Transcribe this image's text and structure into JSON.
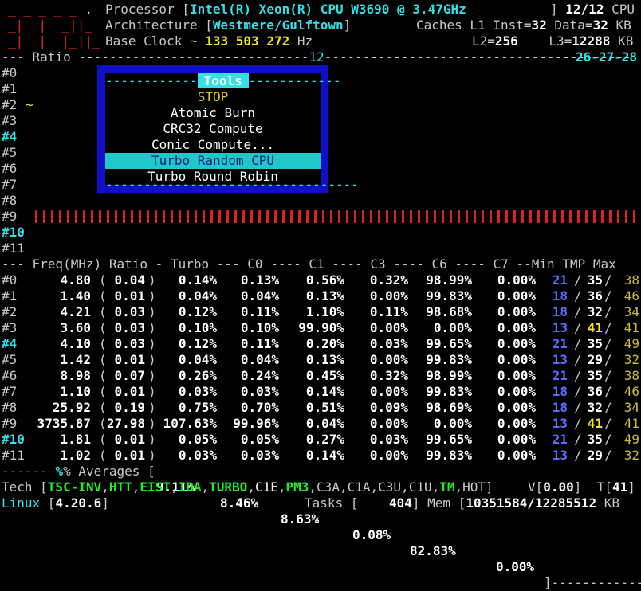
{
  "header": {
    "processor_label": "Processor",
    "processor_value": "Intel(R) Xeon(R) CPU W3690 @ 3.47GHz",
    "cpu_count": "12/12",
    "cpu_label": "CPU",
    "arch_label": "Architecture",
    "arch_value": "Westmere/Gulftown",
    "caches_label": "Caches L1 Inst=",
    "l1_inst": "32",
    "data_label": "Data=",
    "l1_data": "32",
    "kb": "KB",
    "clock_label": "Base Clock",
    "clock_value": "133 503 272",
    "hz": "Hz",
    "l2_label": "L2=",
    "l2": "256",
    "l3_label": "L3=",
    "l3": "12288",
    "ratio_label": "Ratio",
    "ratio_mid": "12",
    "ratio_end": "26-27-28"
  },
  "core_ids": [
    "#0",
    "#1",
    "#2",
    "#3",
    "#4",
    "#5",
    "#6",
    "#7",
    "#8",
    "#9",
    "#10",
    "#11"
  ],
  "tools_menu": {
    "title": "Tools",
    "items": [
      "STOP",
      "Atomic Burn",
      "CRC32 Compute",
      "Conic Compute...",
      "Turbo Random CPU",
      "Turbo Round Robin"
    ],
    "selected": "Turbo Random CPU"
  },
  "table": {
    "headers": [
      "Freq(MHz)",
      "Ratio",
      "Turbo",
      "C0",
      "C1",
      "C3",
      "C6",
      "C7",
      "Min",
      "TMP",
      "Max"
    ],
    "rows": [
      {
        "id": "#0",
        "freq": "4.80",
        "ratio": "0.04",
        "turbo": "0.14%",
        "c0": "0.13%",
        "c1": "0.56%",
        "c3": "0.32%",
        "c6": "98.99%",
        "c7": "0.00%",
        "min": "21",
        "tmp": "35",
        "max": "38"
      },
      {
        "id": "#1",
        "freq": "1.40",
        "ratio": "0.01",
        "turbo": "0.04%",
        "c0": "0.04%",
        "c1": "0.13%",
        "c3": "0.00%",
        "c6": "99.83%",
        "c7": "0.00%",
        "min": "18",
        "tmp": "36",
        "max": "46"
      },
      {
        "id": "#2",
        "freq": "4.21",
        "ratio": "0.03",
        "turbo": "0.12%",
        "c0": "0.11%",
        "c1": "1.10%",
        "c3": "0.11%",
        "c6": "98.68%",
        "c7": "0.00%",
        "min": "18",
        "tmp": "32",
        "max": "34"
      },
      {
        "id": "#3",
        "freq": "3.60",
        "ratio": "0.03",
        "turbo": "0.10%",
        "c0": "0.10%",
        "c1": "99.90%",
        "c3": "0.00%",
        "c6": "0.00%",
        "c7": "0.00%",
        "min": "13",
        "tmp": "41",
        "max": "41"
      },
      {
        "id": "#4",
        "freq": "4.10",
        "ratio": "0.03",
        "turbo": "0.12%",
        "c0": "0.11%",
        "c1": "0.20%",
        "c3": "0.03%",
        "c6": "99.65%",
        "c7": "0.00%",
        "min": "21",
        "tmp": "35",
        "max": "49"
      },
      {
        "id": "#5",
        "freq": "1.42",
        "ratio": "0.01",
        "turbo": "0.04%",
        "c0": "0.04%",
        "c1": "0.13%",
        "c3": "0.00%",
        "c6": "99.83%",
        "c7": "0.00%",
        "min": "13",
        "tmp": "29",
        "max": "32"
      },
      {
        "id": "#6",
        "freq": "8.98",
        "ratio": "0.07",
        "turbo": "0.26%",
        "c0": "0.24%",
        "c1": "0.45%",
        "c3": "0.32%",
        "c6": "98.99%",
        "c7": "0.00%",
        "min": "21",
        "tmp": "35",
        "max": "38"
      },
      {
        "id": "#7",
        "freq": "1.10",
        "ratio": "0.01",
        "turbo": "0.03%",
        "c0": "0.03%",
        "c1": "0.14%",
        "c3": "0.00%",
        "c6": "99.83%",
        "c7": "0.00%",
        "min": "18",
        "tmp": "36",
        "max": "46"
      },
      {
        "id": "#8",
        "freq": "25.92",
        "ratio": "0.19",
        "turbo": "0.75%",
        "c0": "0.70%",
        "c1": "0.51%",
        "c3": "0.09%",
        "c6": "98.69%",
        "c7": "0.00%",
        "min": "18",
        "tmp": "32",
        "max": "34"
      },
      {
        "id": "#9",
        "freq": "3735.87",
        "ratio": "27.98",
        "turbo": "107.63%",
        "c0": "99.96%",
        "c1": "0.04%",
        "c3": "0.00%",
        "c6": "0.00%",
        "c7": "0.00%",
        "min": "13",
        "tmp": "41",
        "max": "41"
      },
      {
        "id": "#10",
        "freq": "1.81",
        "ratio": "0.01",
        "turbo": "0.05%",
        "c0": "0.05%",
        "c1": "0.27%",
        "c3": "0.03%",
        "c6": "99.65%",
        "c7": "0.00%",
        "min": "21",
        "tmp": "35",
        "max": "49"
      },
      {
        "id": "#11",
        "freq": "1.02",
        "ratio": "0.01",
        "turbo": "0.03%",
        "c0": "0.03%",
        "c1": "0.14%",
        "c3": "0.00%",
        "c6": "99.83%",
        "c7": "0.00%",
        "min": "13",
        "tmp": "29",
        "max": "32"
      }
    ],
    "averages_label": "% Averages [",
    "averages": {
      "turbo": "9.11%",
      "c0": "8.46%",
      "c1": "8.63%",
      "c3": "0.08%",
      "c6": "82.83%",
      "c7": "0.00%"
    }
  },
  "tech": {
    "label": "Tech [",
    "enabled": [
      "TSC-INV",
      "HTT",
      "EIST",
      "IDA",
      "TURBO"
    ],
    "plain1": [
      "C1E"
    ],
    "enabled2": [
      "PM3"
    ],
    "disabled": [
      "C3A",
      "C1A",
      "C3U",
      "C1U"
    ],
    "enabled3": [
      "TM"
    ],
    "disabled2": [
      "HOT"
    ],
    "v_label": "V[",
    "v_value": "0.00",
    "t_label": "T[",
    "t_value": "41"
  },
  "status": {
    "os": "Linux",
    "kernel": "4.20.6",
    "tasks_label": "Tasks [",
    "tasks": "404",
    "mem_label": "Mem [",
    "mem": "10351584/12285512",
    "mem_unit": "KB"
  },
  "colors": {
    "background": "#000000",
    "cyan": "#33e0e8",
    "yellow": "#f0e030",
    "red": "#e02020",
    "green": "#20f020",
    "blue": "#5a6bff",
    "menu_border": "#1010c8"
  }
}
